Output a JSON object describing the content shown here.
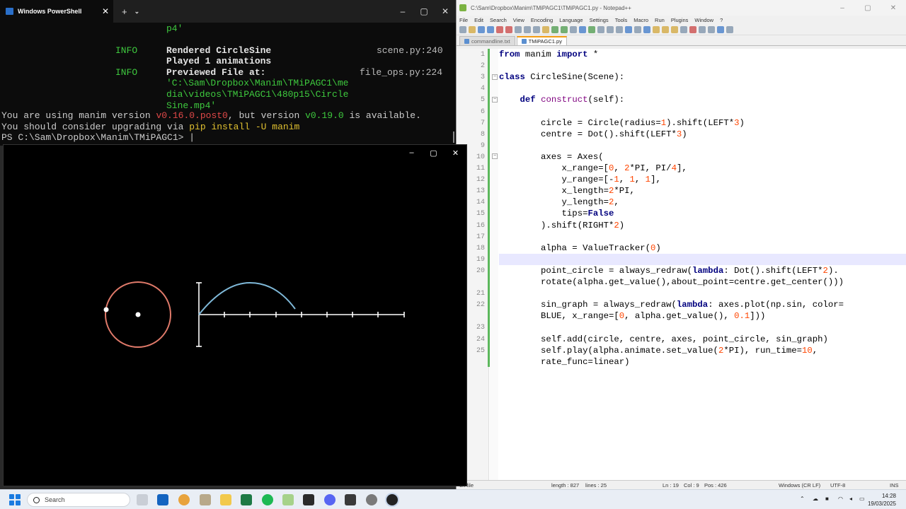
{
  "notepad": {
    "title": "C:\\Sam\\Dropbox\\Manim\\TMiPAGC1\\TMiPAGC1.py - Notepad++",
    "menu": [
      "File",
      "Edit",
      "Search",
      "View",
      "Encoding",
      "Language",
      "Settings",
      "Tools",
      "Macro",
      "Run",
      "Plugins",
      "Window",
      "?"
    ],
    "tabs": [
      {
        "label": "commandline.txt",
        "active": false
      },
      {
        "label": "TMiPAGC1.py",
        "active": true
      }
    ],
    "line_numbers": [
      "1",
      "2",
      "3",
      "4",
      "5",
      "6",
      "7",
      "8",
      "9",
      "10",
      "11",
      "12",
      "13",
      "14",
      "15",
      "16",
      "17",
      "18",
      "19",
      "20",
      "21",
      "22",
      "23",
      "24",
      "25"
    ],
    "code": [
      "from manim import *",
      "",
      "class CircleSine(Scene):",
      "",
      "    def construct(self):",
      "",
      "        circle = Circle(radius=1).shift(LEFT*3)",
      "        centre = Dot().shift(LEFT*3)",
      "",
      "        axes = Axes(",
      "            x_range=[0, 2*PI, PI/4],",
      "            y_range=[-1, 1, 1],",
      "            x_length=2*PI,",
      "            y_length=2,",
      "            tips=False",
      "        ).shift(RIGHT*2)",
      "",
      "        alpha = ValueTracker(0)",
      "",
      "        point_circle = always_redraw(lambda: Dot().shift(LEFT*2).",
      "        rotate(alpha.get_value(),about_point=centre.get_center()))",
      "",
      "        sin_graph = always_redraw(lambda: axes.plot(np.sin, color=",
      "        BLUE, x_range=[0, alpha.get_value(), 0.1]))",
      "",
      "        self.add(circle, centre, axes, point_circle, sin_graph)",
      "        self.play(alpha.animate.set_value(2*PI), run_time=10,",
      "        rate_func=linear)"
    ],
    "status": {
      "filetype": "on file",
      "length": "length : 827",
      "lines": "lines : 25",
      "ln": "Ln : 19",
      "col": "Col : 9",
      "pos": "Pos : 426",
      "eol": "Windows (CR LF)",
      "encoding": "UTF-8",
      "ins": "INS"
    }
  },
  "powershell": {
    "tab_title": "Windows PowerShell",
    "lines": {
      "l0": "p4'",
      "info1_tag": "INFO",
      "info1_msg": "Rendered CircleSine",
      "info1_src": "scene.py:240",
      "played": "Played 1 animations",
      "info2_tag": "INFO",
      "info2_msg": "Previewed File at:",
      "info2_src": "file_ops.py:224",
      "path1": "'C:\\Sam\\Dropbox\\Manim\\TMiPAGC1\\me",
      "path2": "dia\\videos\\TMiPAGC1\\480p15\\Circle",
      "path3": "Sine.mp4'",
      "ver_a": "You are using manim version ",
      "ver_b": "v0.16.0.post0",
      "ver_c": ", but version ",
      "ver_d": "v0.19.0",
      "ver_e": " is available.",
      "up_a": "You should consider upgrading via ",
      "up_b": "pip install -U manim",
      "prompt": "PS C:\\Sam\\Dropbox\\Manim\\TMiPAGC1> "
    }
  },
  "player": {
    "controls": [
      "minimize-icon",
      "maximize-icon",
      "close-icon"
    ]
  },
  "colors": {
    "circle": "#e07a6a",
    "sine": "#7fb9d9",
    "axes": "#ffffff",
    "terminal_bg": "#0c0c0c",
    "info_green": "#3ec93e",
    "version_red": "#e04848",
    "pip_yellow": "#e0c030"
  },
  "taskbar": {
    "search_placeholder": "Search",
    "time": "14:28",
    "date": "19/03/2025"
  }
}
